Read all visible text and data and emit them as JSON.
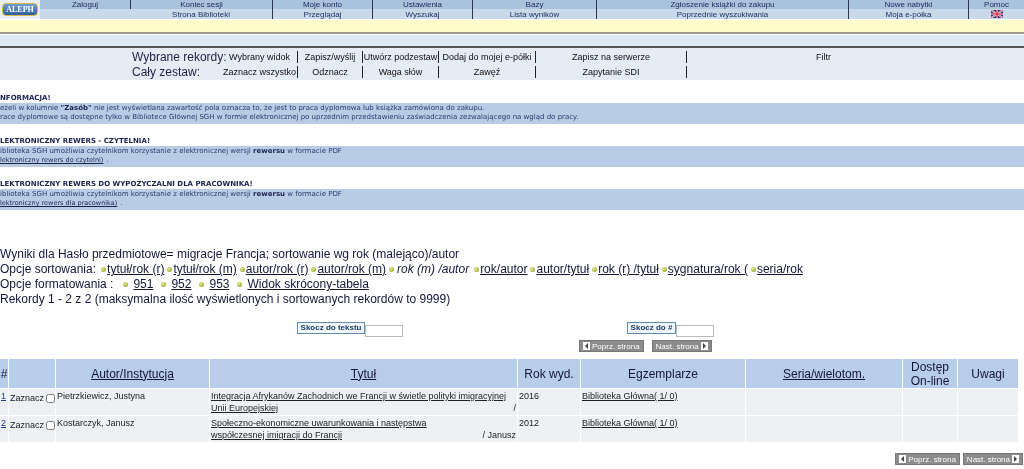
{
  "header": {
    "logo": "ALEPH",
    "top_menu": [
      "Zaloguj",
      "Koniec sesji",
      "Moje konto",
      "Ustawienia",
      "Bazy",
      "Zgłoszenie książki do zakupu",
      "Nowe nabytki",
      "Pomoc"
    ],
    "bottom_menu": [
      "Strona Biblioteki",
      "Przeglądaj",
      "Wyszukaj",
      "Lista wyników",
      "Poprzednie wyszukiwania",
      "Moja e-półka"
    ]
  },
  "selection_bar": [
    {
      "label": "Wybrane rekordy:",
      "items": [
        "Wybrany widok",
        "Zapisz/wyślij",
        "Utwórz podzestaw",
        "Dodaj do mojej e-półki",
        "Zapisz na serwerze",
        "Filtr"
      ]
    },
    {
      "label": "Cały zestaw:",
      "items": [
        "Zaznacz wszystko",
        "Odznacz",
        "Waga słów",
        "Zawęź",
        "Zapytanie SDI"
      ]
    }
  ],
  "notices": [
    {
      "heading": "NFORMACJA!",
      "lines": [
        {
          "kind": "text",
          "text": "eżeli w kolumnie **\"Zasób\"** nie jest wyświetlana zawartość pola oznacza to, że jest to praca dyplomowa lub książka zamówiona do zakupu."
        },
        {
          "kind": "text",
          "text": "race dyplomowe są dostępne tylko w Bibliotece Głównej SGH w formie elektronicznej po uprzednim przedstawieniu zaświadczenia zezwalającego na wgląd do pracy."
        }
      ]
    },
    {
      "heading": "LEKTRONICZNY REWERS - CZYTELNIA!",
      "lines": [
        {
          "kind": "text",
          "text": "iblioteka SGH umożliwia czytelnikom korzystanie z elektronicznej wersji **rewersu** w formacie PDF"
        },
        {
          "kind": "link",
          "text": "lektroniczny rewers do czytelni)",
          "suffix": "."
        }
      ]
    },
    {
      "heading": "LEKTRONICZNY REWERS DO WYPOŻYCZALNI DLA PRACOWNIKA!",
      "lines": [
        {
          "kind": "text",
          "text": "iblioteka SGH umożliwia czytelnikom korzystanie z elektronicznej wersji **rewersu** w formacie PDF"
        },
        {
          "kind": "link",
          "text": "lektroniczny rewers dla pracownika)",
          "suffix": "."
        }
      ]
    }
  ],
  "results": {
    "summary": "Wyniki dla Hasło przedmiotowe= migracje Francja; sortowanie wg rok (malejąco)/autor",
    "sort_label": "Opcje sortowania:",
    "sort_options": [
      {
        "label": "tytuł/rok (r)",
        "selected": false
      },
      {
        "label": "tytuł/rok (m)",
        "selected": false
      },
      {
        "label": "autor/rok (r)",
        "selected": false
      },
      {
        "label": "autor/rok (m)",
        "selected": false
      },
      {
        "label": "rok (m) /autor",
        "selected": true
      },
      {
        "label": "rok/autor",
        "selected": false
      },
      {
        "label": "autor/tytuł",
        "selected": false
      },
      {
        "label": "rok (r) /tytuł",
        "selected": false
      },
      {
        "label": "sygnatura/rok (",
        "selected": false
      },
      {
        "label": "seria/rok",
        "selected": false
      }
    ],
    "format_label": "Opcje formatowania :",
    "format_options": [
      "951",
      "952",
      "953",
      "Widok skrócony-tabela"
    ],
    "records_info": "Rekordy 1 - 2 z 2 (maksymalna ilość wyświetlonych i sortowanych rekordów to 9999)"
  },
  "jump": [
    "Skocz do tekstu",
    "Skocz do #"
  ],
  "pager_top": {
    "prev": "Poprz. strona",
    "next": "Nast. strona"
  },
  "table": {
    "columns": [
      {
        "label": "#",
        "link": false
      },
      {
        "label": "Autor/Instytucja",
        "link": true
      },
      {
        "label": "Tytuł",
        "link": true
      },
      {
        "label": "Rok wyd.",
        "link": false
      },
      {
        "label": "Egzemplarze",
        "link": false
      },
      {
        "label": "Seria/wielotom.",
        "link": true
      },
      {
        "label": "Dostęp On-line",
        "link": false
      },
      {
        "label": "Uwagi",
        "link": false
      }
    ],
    "rows": [
      {
        "number": "1",
        "select_label": "Zaznacz",
        "checked": false,
        "author": "Pietrzkiewicz, Justyna",
        "title_link": "Integracja Afrykanów Zachodnich we Francji w świetle polityki imigracyjnej Unii Europejskiej",
        "title_rest": "/",
        "year": "2016",
        "copies": "Biblioteka Główna( 1/ 0)"
      },
      {
        "number": "2",
        "select_label": "Zaznacz",
        "checked": false,
        "author": "Kostarczyk, Janusz",
        "title_link": "Społeczno-ekonomiczne uwarunkowania i następstwa współczesnej imigracji do Francji",
        "title_rest": "/ Janusz",
        "year": "2012",
        "copies": "Biblioteka Główna( 1/ 0)"
      }
    ]
  },
  "pager_bottom": {
    "prev": "Poprz. strona",
    "next": "Nast. strona"
  }
}
